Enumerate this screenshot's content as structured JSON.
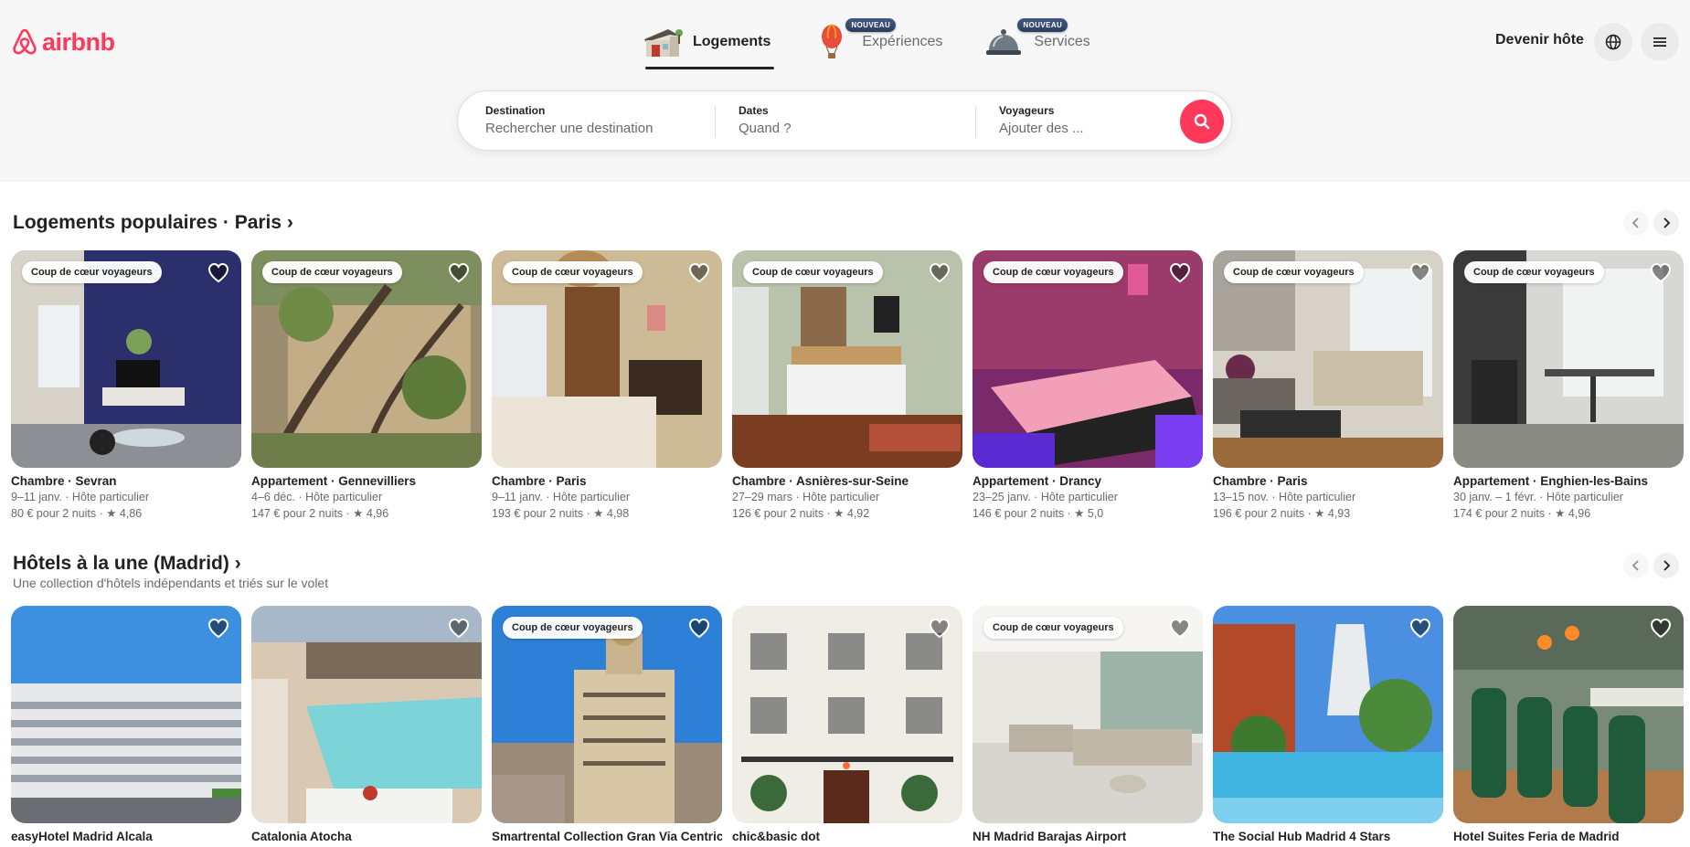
{
  "brand": {
    "name": "airbnb",
    "color": "#ff385c"
  },
  "nav": {
    "tabs": [
      {
        "label": "Logements",
        "icon": "house-icon",
        "active": true,
        "badge": ""
      },
      {
        "label": "Expériences",
        "icon": "hot-air-balloon-icon",
        "active": false,
        "badge": "NOUVEAU"
      },
      {
        "label": "Services",
        "icon": "service-bell-icon",
        "active": false,
        "badge": "NOUVEAU"
      }
    ]
  },
  "header": {
    "host_label": "Devenir hôte",
    "globe_icon": "globe-icon",
    "menu_icon": "hamburger-menu-icon"
  },
  "search": {
    "destination_label": "Destination",
    "destination_placeholder": "Rechercher une destination",
    "dates_label": "Dates",
    "dates_placeholder": "Quand ?",
    "guests_label": "Voyageurs",
    "guests_placeholder": "Ajouter des ...",
    "button_icon": "search-icon"
  },
  "sections": [
    {
      "title": "Logements populaires · Paris ›",
      "subtitle": "",
      "cards": [
        {
          "title": "Chambre · Sevran",
          "line1": "9–11 janv. · Hôte particulier",
          "line2": "80 € pour 2 nuits · ★ 4,86",
          "badge": "Coup de cœur voyageurs"
        },
        {
          "title": "Appartement · Gennevilliers",
          "line1": "4–6 déc. · Hôte particulier",
          "line2": "147 € pour 2 nuits · ★ 4,96",
          "badge": "Coup de cœur voyageurs"
        },
        {
          "title": "Chambre · Paris",
          "line1": "9–11 janv. · Hôte particulier",
          "line2": "193 € pour 2 nuits · ★ 4,98",
          "badge": "Coup de cœur voyageurs"
        },
        {
          "title": "Chambre · Asnières-sur-Seine",
          "line1": "27–29 mars · Hôte particulier",
          "line2": "126 € pour 2 nuits · ★ 4,92",
          "badge": "Coup de cœur voyageurs"
        },
        {
          "title": "Appartement · Drancy",
          "line1": "23–25 janv. · Hôte particulier",
          "line2": "146 € pour 2 nuits · ★ 5,0",
          "badge": "Coup de cœur voyageurs"
        },
        {
          "title": "Chambre · Paris",
          "line1": "13–15 nov. · Hôte particulier",
          "line2": "196 € pour 2 nuits · ★ 4,93",
          "badge": "Coup de cœur voyageurs"
        },
        {
          "title": "Appartement · Enghien-les-Bains",
          "line1": "30 janv. – 1 févr. · Hôte particulier",
          "line2": "174 € pour 2 nuits · ★ 4,96",
          "badge": "Coup de cœur voyageurs"
        }
      ]
    },
    {
      "title": "Hôtels à la une (Madrid) ›",
      "subtitle": "Une collection d'hôtels indépendants et triés sur le volet",
      "cards": [
        {
          "title": "easyHotel Madrid Alcala",
          "line1": "",
          "line2": "",
          "badge": ""
        },
        {
          "title": "Catalonia Atocha",
          "line1": "",
          "line2": "",
          "badge": ""
        },
        {
          "title": "Smartrental Collection Gran Via Centric",
          "line1": "",
          "line2": "",
          "badge": "Coup de cœur voyageurs"
        },
        {
          "title": "chic&basic dot",
          "line1": "",
          "line2": "",
          "badge": ""
        },
        {
          "title": "NH Madrid Barajas Airport",
          "line1": "",
          "line2": "",
          "badge": "Coup de cœur voyageurs"
        },
        {
          "title": "The Social Hub Madrid 4 Stars",
          "line1": "",
          "line2": "",
          "badge": ""
        },
        {
          "title": "Hotel Suites Feria de Madrid",
          "line1": "",
          "line2": "",
          "badge": ""
        }
      ]
    }
  ],
  "colors": {
    "accent": "#ff385c",
    "text": "#222222",
    "muted": "#6a6a6a"
  }
}
